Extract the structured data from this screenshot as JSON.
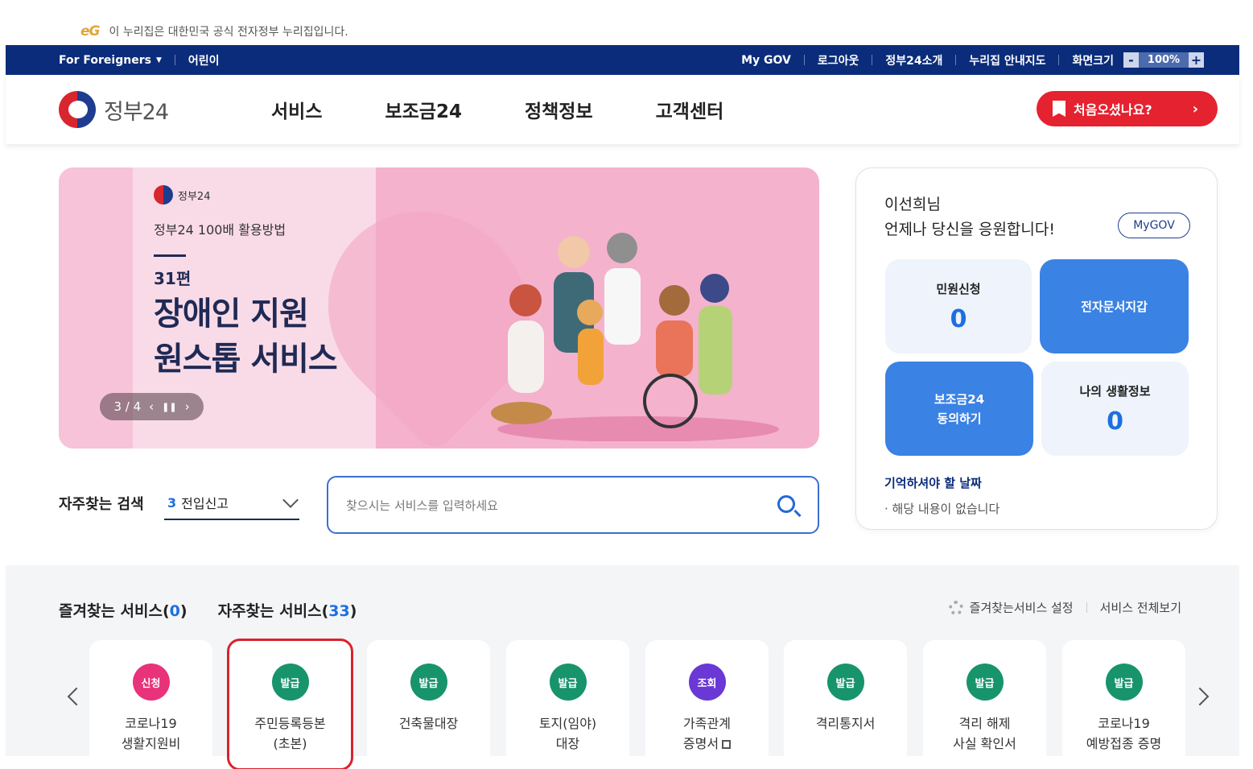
{
  "notice": {
    "logo": "eG",
    "text": "이 누리집은 대한민국 공식 전자정부 누리집입니다."
  },
  "topbar": {
    "foreigners": "For Foreigners",
    "kids": "어린이",
    "mygov": "My GOV",
    "logout": "로그아웃",
    "intro": "정부24소개",
    "sitemap": "누리집 안내지도",
    "screen_size": "화면크기",
    "zoom_minus": "-",
    "zoom_value": "100%",
    "zoom_plus": "+"
  },
  "header": {
    "logo_text": "정부24",
    "menu": [
      "서비스",
      "보조금24",
      "정책정보",
      "고객센터"
    ],
    "first_visit": "처음오셨나요?"
  },
  "banner": {
    "logo_text": "정부24",
    "subtitle": "정부24 100배 활용방법",
    "episode": "31편",
    "title_line1": "장애인 지원",
    "title_line2": "원스톱 서비스",
    "pager": "3 / 4"
  },
  "mypanel": {
    "greeting_name": "이선희님",
    "greeting_msg": "언제나 당신을 응원합니다!",
    "mygov_button": "MyGOV",
    "tiles": {
      "civil_apps_label": "민원신청",
      "civil_apps_count": "0",
      "wallet_label": "전자문서지갑",
      "subsidy_line1": "보조금24",
      "subsidy_line2": "동의하기",
      "life_label": "나의 생활정보",
      "life_count": "0"
    },
    "remember_title": "기억하셔야 할 날짜",
    "remember_empty": "해당 내용이 없습니다"
  },
  "frequent_search": {
    "label": "자주찾는 검색",
    "selected_rank": "3",
    "selected_text": "전입신고",
    "placeholder": "찾으시는 서비스를 입력하세요"
  },
  "services": {
    "favorites_label": "즐겨찾는 서비스(",
    "favorites_count": "0",
    "frequent_label": "자주찾는 서비스(",
    "frequent_count": "33",
    "close_paren": ")",
    "settings_link": "즐겨찾는서비스 설정",
    "all_link": "서비스 전체보기",
    "cards": [
      {
        "badge": "신청",
        "name": "코로나19\n생활지원비",
        "color": "#e8327a"
      },
      {
        "badge": "발급",
        "name": "주민등록등본\n(초본)",
        "color": "#17946b"
      },
      {
        "badge": "발급",
        "name": "건축물대장",
        "color": "#17946b"
      },
      {
        "badge": "발급",
        "name": "토지(임야)\n대장",
        "color": "#17946b"
      },
      {
        "badge": "조회",
        "name": "가족관계\n증명서",
        "color": "#6a38d4"
      },
      {
        "badge": "발급",
        "name": "격리통지서",
        "color": "#17946b"
      },
      {
        "badge": "발급",
        "name": "격리 해제\n사실 확인서",
        "color": "#17946b"
      },
      {
        "badge": "발급",
        "name": "코로나19\n예방접종 증명",
        "color": "#17946b"
      }
    ]
  }
}
